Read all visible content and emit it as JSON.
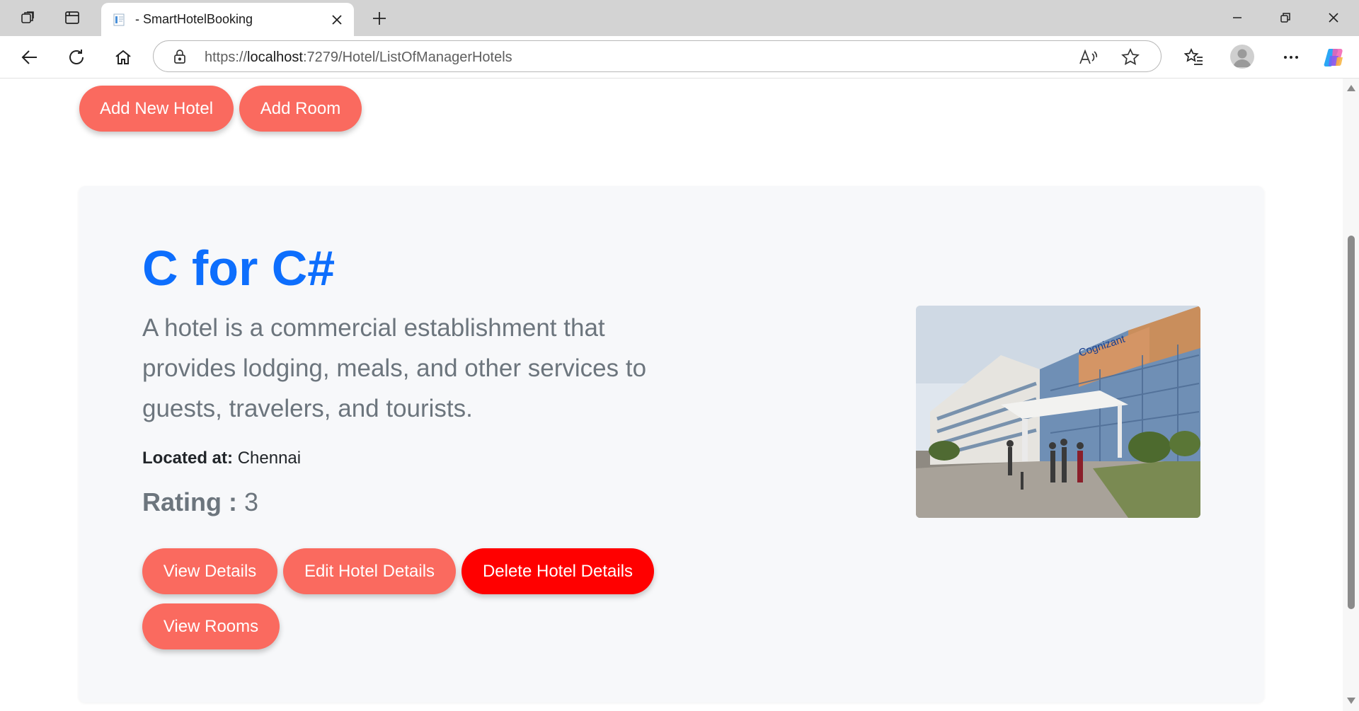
{
  "browser": {
    "tab_title": "- SmartHotelBooking",
    "url_scheme": "https://",
    "url_host": "localhost",
    "url_rest": ":7279/Hotel/ListOfManagerHotels"
  },
  "top_actions": {
    "add_hotel": "Add New Hotel",
    "add_room": "Add Room"
  },
  "hotel": {
    "name": "C for C#",
    "description": "A hotel is a commercial establishment that provides lodging, meals, and other services to guests, travelers, and tourists.",
    "location_label": "Located at:",
    "location": "Chennai",
    "rating_label": "Rating :",
    "rating": "3",
    "image_sign_text": "Cognizant",
    "actions": {
      "view_details": "View Details",
      "edit": "Edit Hotel Details",
      "delete": "Delete Hotel Details",
      "view_rooms": "View Rooms"
    }
  },
  "colors": {
    "button_coral": "#fa6a5f",
    "button_danger": "#ff0000",
    "title_blue": "#0d6efd",
    "muted_text": "#6c757d",
    "card_bg": "#f7f8fa"
  }
}
